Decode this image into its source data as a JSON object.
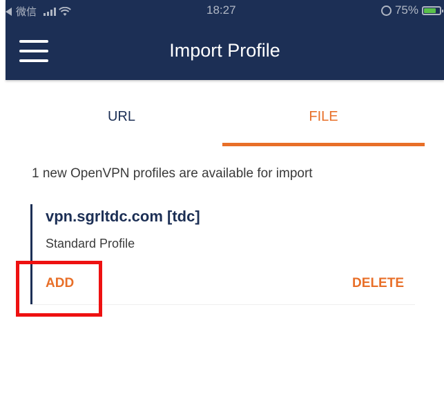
{
  "status_bar": {
    "carrier": "微信",
    "time": "18:27",
    "battery_percent": "75%",
    "battery_level": 0.75
  },
  "header": {
    "title": "Import Profile",
    "background_color": "#1c2f55"
  },
  "tabs": [
    {
      "label": "URL",
      "active": false
    },
    {
      "label": "FILE",
      "active": true
    }
  ],
  "accent_color": "#e86f28",
  "info_text": "1 new OpenVPN profiles are available for import",
  "profile": {
    "name": "vpn.sgrltdc.com [tdc]",
    "type": "Standard Profile",
    "add_label": "ADD",
    "delete_label": "DELETE"
  },
  "annotation": {
    "highlight_color": "#ee1111",
    "target": "add-button"
  }
}
